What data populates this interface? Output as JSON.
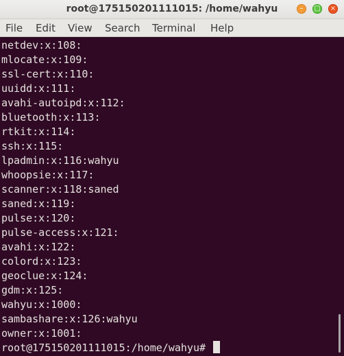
{
  "window": {
    "title": "root@175150201111015: /home/wahyu",
    "buttons": [
      "minimize",
      "maximize",
      "close"
    ]
  },
  "menu": {
    "items": [
      "File",
      "Edit",
      "View",
      "Search",
      "Terminal",
      "Help"
    ]
  },
  "terminal": {
    "lines": [
      "netdev:x:108:",
      "mlocate:x:109:",
      "ssl-cert:x:110:",
      "uuidd:x:111:",
      "avahi-autoipd:x:112:",
      "bluetooth:x:113:",
      "rtkit:x:114:",
      "ssh:x:115:",
      "lpadmin:x:116:wahyu",
      "whoopsie:x:117:",
      "scanner:x:118:saned",
      "saned:x:119:",
      "pulse:x:120:",
      "pulse-access:x:121:",
      "avahi:x:122:",
      "colord:x:123:",
      "geoclue:x:124:",
      "gdm:x:125:",
      "wahyu:x:1000:",
      "sambashare:x:126:wahyu",
      "owner:x:1001:"
    ],
    "prompt": "root@175150201111015:/home/wahyu# ",
    "colors": {
      "background": "#300a24",
      "foreground": "#e6e2e0"
    }
  }
}
